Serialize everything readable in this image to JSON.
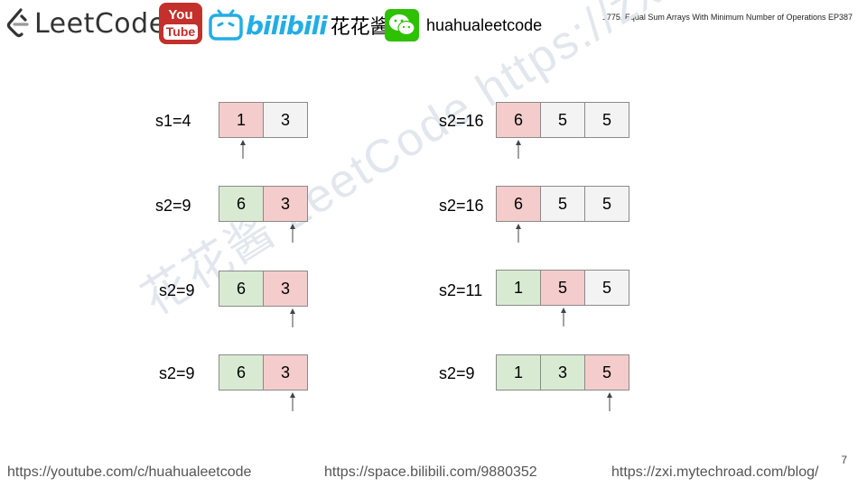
{
  "header": {
    "leetcode_text": "LeetCode",
    "youtube_line1": "You",
    "youtube_line2": "Tube",
    "bilibili_text": "bilibili",
    "hua_text": "花花酱",
    "handle": "huahualeetcode",
    "episode_title": "1775. Equal Sum Arrays With Minimum Number of Operations EP387"
  },
  "watermark": "花花酱 LeetCode https://zxi.mytechroad.com/blog/",
  "left_column": {
    "rows": [
      {
        "label": "s1=4",
        "cells": [
          "1",
          "3"
        ],
        "colors": [
          "red",
          "gray"
        ],
        "pointer_index": 0
      },
      {
        "label": "s2=9",
        "cells": [
          "6",
          "3"
        ],
        "colors": [
          "green",
          "red"
        ],
        "pointer_index": 1
      },
      {
        "label": "s2=9",
        "cells": [
          "6",
          "3"
        ],
        "colors": [
          "green",
          "red"
        ],
        "pointer_index": 1
      },
      {
        "label": "s2=9",
        "cells": [
          "6",
          "3"
        ],
        "colors": [
          "green",
          "red"
        ],
        "pointer_index": 1
      }
    ]
  },
  "right_column": {
    "rows": [
      {
        "label": "s2=16",
        "cells": [
          "6",
          "5",
          "5"
        ],
        "colors": [
          "red",
          "gray",
          "gray"
        ],
        "pointer_index": 0
      },
      {
        "label": "s2=16",
        "cells": [
          "6",
          "5",
          "5"
        ],
        "colors": [
          "red",
          "gray",
          "gray"
        ],
        "pointer_index": 0
      },
      {
        "label": "s2=11",
        "cells": [
          "1",
          "5",
          "5"
        ],
        "colors": [
          "green",
          "red",
          "gray"
        ],
        "pointer_index": 1
      },
      {
        "label": "s2=9",
        "cells": [
          "1",
          "3",
          "5"
        ],
        "colors": [
          "green",
          "green",
          "red"
        ],
        "pointer_index": 2
      }
    ]
  },
  "colors": {
    "red": "#f4cccc",
    "green": "#d9ead3",
    "gray": "#f3f3f3"
  },
  "footer": {
    "youtube_url": "https://youtube.com/c/huahualeetcode",
    "bilibili_url": "https://space.bilibili.com/9880352",
    "blog_url": "https://zxi.mytechroad.com/blog/"
  },
  "page_number": "7"
}
